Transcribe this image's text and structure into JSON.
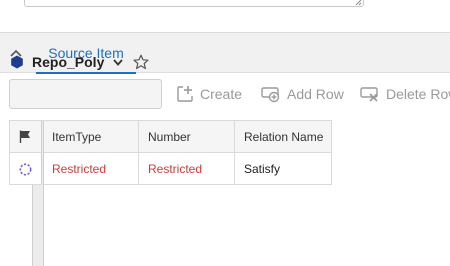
{
  "panel": {
    "tab_label": "Source Item"
  },
  "item": {
    "name": "Repo_Poly"
  },
  "search": {
    "value": "",
    "placeholder": ""
  },
  "toolbar": {
    "create_label": "Create",
    "add_row_label": "Add Row",
    "delete_row_label": "Delete Row"
  },
  "grid": {
    "columns": [
      "ItemType",
      "Number",
      "Relation Name"
    ],
    "rows": [
      {
        "cells": [
          "Restricted",
          "Restricted",
          "Satisfy"
        ]
      }
    ]
  },
  "colors": {
    "accent": "#1f6fc5",
    "restricted": "#d23a3a",
    "disabled_tool": "#9a9a9a",
    "item_icon": "#1f3d8f"
  },
  "icons": {
    "collapse": "chevron-up-icon",
    "item": "hexagon-icon",
    "dropdown": "chevron-down-icon",
    "favorite": "star-outline-icon",
    "create": "create-plus-icon",
    "add_row": "add-row-icon",
    "delete_row": "delete-row-icon",
    "flag": "flag-icon",
    "row_status": "dashed-circle-icon"
  }
}
